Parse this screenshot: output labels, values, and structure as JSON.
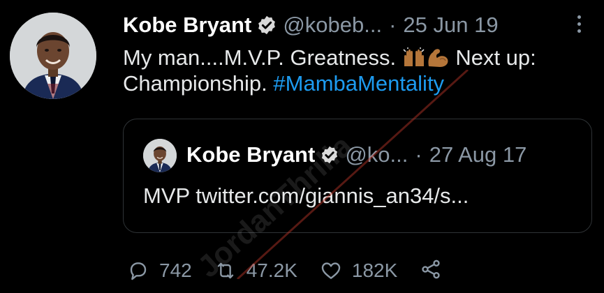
{
  "tweet": {
    "author_name": "Kobe Bryant",
    "handle": "@kobeb...",
    "separator": "·",
    "date": "25 Jun 19",
    "text_main": "My man....M.V.P. Greatness. ",
    "text_after_emoji": " Next up: Championship. ",
    "hashtag": "#MambaMentality"
  },
  "quoted": {
    "author_name": "Kobe Bryant",
    "handle": "@ko...",
    "separator": "·",
    "date": "27 Aug 17",
    "text": "MVP twitter.com/giannis_an34/s..."
  },
  "actions": {
    "replies": "742",
    "retweets": "47.2K",
    "likes": "182K"
  },
  "icons": {
    "verified": "verified-badge-icon",
    "more": "more-options-icon",
    "reply": "reply-icon",
    "retweet": "retweet-icon",
    "like": "heart-icon",
    "share": "share-icon",
    "emoji1": "raising-hands-emoji",
    "emoji2": "flexed-biceps-emoji"
  },
  "watermark": "JordanThrilla",
  "colors": {
    "background": "#000000",
    "text": "#e7e9ea",
    "secondary": "#8b98a5",
    "link": "#1d9bf0",
    "border": "#2f3336",
    "emoji": "#b5763a"
  }
}
